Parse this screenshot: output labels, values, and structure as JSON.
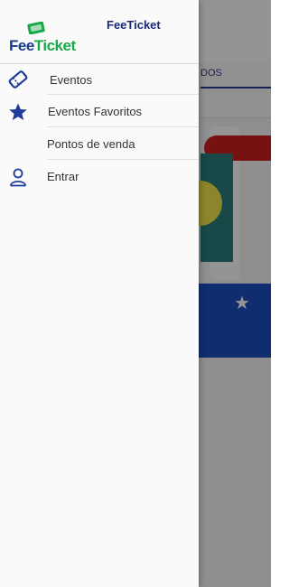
{
  "drawer": {
    "app_title": "FeeTicket",
    "logo": {
      "text_part1": "Fee",
      "text_part2": "Ticket"
    },
    "items": [
      {
        "label": "Eventos",
        "icon": "ticket-icon"
      },
      {
        "label": "Eventos Favoritos",
        "icon": "star-icon"
      },
      {
        "label": "Pontos de venda",
        "icon": ""
      },
      {
        "label": "Entrar",
        "icon": "user-icon"
      }
    ]
  },
  "background": {
    "tab_text": "DOS"
  },
  "colors": {
    "brand_blue": "#1a2a7a",
    "brand_green": "#1aa84a",
    "icon_blue": "#1f3c9a",
    "band_blue": "#1d4fbf"
  }
}
